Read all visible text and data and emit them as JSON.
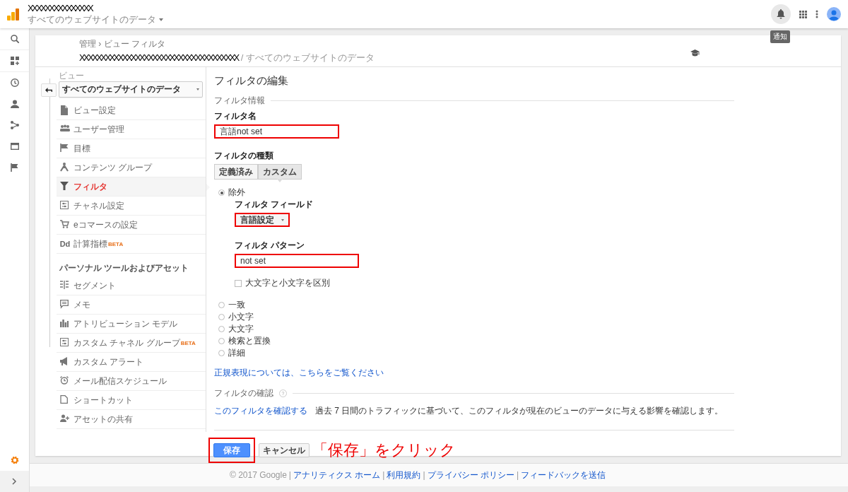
{
  "topbar": {
    "account": "XXXXXXXXXXXXXXX",
    "property": "すべてのウェブサイトのデータ",
    "tooltip": "通知"
  },
  "header": {
    "breadcrumb": "管理 › ビュー フィルタ",
    "account": "XXXXXXXXXXXXXXXXXXXXXXXXXXXXXXXXXXXXX",
    "separator": "/",
    "view": "すべてのウェブサイトのデータ"
  },
  "view_selector": {
    "label": "ビュー",
    "value": "すべてのウェブサイトのデータ"
  },
  "nav": {
    "items": [
      {
        "label": "ビュー設定",
        "selected": false
      },
      {
        "label": "ユーザー管理",
        "selected": false
      },
      {
        "label": "目標",
        "selected": false
      },
      {
        "label": "コンテンツ グループ",
        "selected": false
      },
      {
        "label": "フィルタ",
        "selected": true
      },
      {
        "label": "チャネル設定",
        "selected": false
      },
      {
        "label": "eコマースの設定",
        "selected": false
      },
      {
        "label": "計算指標",
        "glyph": "Dd",
        "badge": "BETA",
        "selected": false
      }
    ],
    "section_title": "パーソナル ツールおよびアセット",
    "personal_items": [
      {
        "label": "セグメント"
      },
      {
        "label": "メモ"
      },
      {
        "label": "アトリビューション モデル"
      },
      {
        "label": "カスタム チャネル グループ",
        "badge": "BETA"
      },
      {
        "label": "カスタム アラート"
      },
      {
        "label": "メール配信スケジュール"
      },
      {
        "label": "ショートカット"
      },
      {
        "label": "アセットの共有"
      }
    ]
  },
  "editor": {
    "title": "フィルタの編集",
    "info_heading": "フィルタ情報",
    "name_label": "フィルタ名",
    "name_field": {
      "value": "言語not set",
      "highlighted": true
    },
    "type_label": "フィルタの種類",
    "type_tabs": [
      {
        "label": "定義済み",
        "selected": false
      },
      {
        "label": "カスタム",
        "selected": true
      }
    ],
    "options": [
      {
        "label": "除外",
        "selected": true
      },
      {
        "label": "一致",
        "selected": false
      },
      {
        "label": "小文字",
        "selected": false
      },
      {
        "label": "大文字",
        "selected": false
      },
      {
        "label": "検索と置換",
        "selected": false
      },
      {
        "label": "詳細",
        "selected": false
      }
    ],
    "field_label": "フィルタ フィールド",
    "field_select": {
      "value": "言語設定",
      "highlighted": true
    },
    "pattern_label": "フィルタ パターン",
    "pattern_field": {
      "value": "not set",
      "highlighted": true
    },
    "case_label": "大文字と小文字を区別",
    "case_checked": false,
    "regex_link": "正規表現については、こちらをご覧ください",
    "verify_heading": "フィルタの確認",
    "help_glyph": "?",
    "verify_link": "このフィルタを確認する",
    "verify_text": "過去 7 日間のトラフィックに基づいて、このフィルタが現在のビューのデータに与える影響を確認します。",
    "save_button": {
      "label": "保存",
      "highlighted": true
    },
    "cancel_button": {
      "label": "キャンセル"
    },
    "annotation": "「保存」をクリック"
  },
  "footer": {
    "copyright": "© 2017 Google",
    "separator": "|",
    "links": [
      "アナリティクス ホーム",
      "利用規約",
      "プライバシー ポリシー",
      "フィードバックを送信"
    ]
  }
}
